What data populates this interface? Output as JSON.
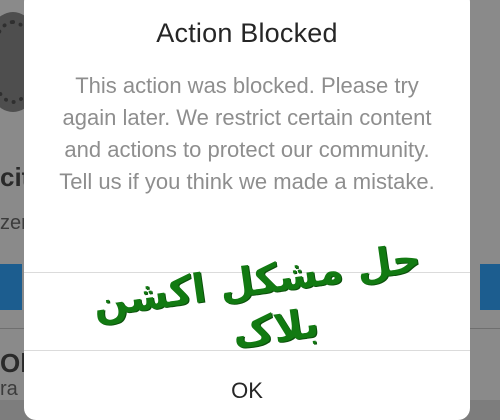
{
  "background": {
    "fragments": [
      "cit",
      "zer",
      "Oliv",
      "ra"
    ]
  },
  "dialog": {
    "title": "Action Blocked",
    "message": "This action was blocked. Please try again later. We restrict certain content and actions to protect our community. Tell us if you think we made a mistake.",
    "ok_label": "OK"
  },
  "overlay": {
    "caption_line1": "حل مشکل اکشن",
    "caption_line2": "بلاک"
  },
  "colors": {
    "caption_green": "#127a12",
    "dialog_bg": "#ffffff",
    "title_text": "#262626",
    "body_text": "#8e8e8e",
    "background_dim": "#8a8a8a",
    "background_button": "#1c5d8f"
  }
}
